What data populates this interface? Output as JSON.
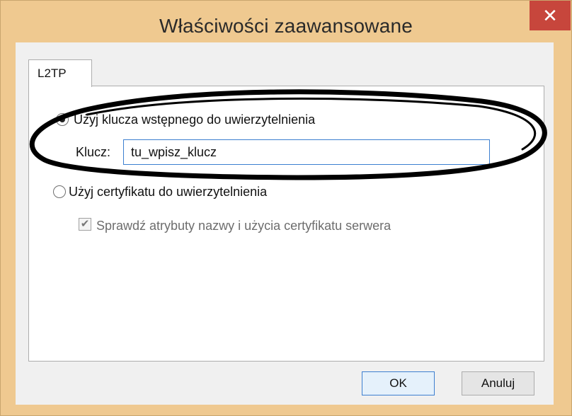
{
  "window": {
    "title": "Właściwości zaawansowane"
  },
  "tab": {
    "label": "L2TP"
  },
  "options": {
    "preshared_key_label": "Użyj klucza wstępnego do uwierzytelnienia",
    "key_label": "Klucz:",
    "key_value": "tu_wpisz_klucz",
    "certificate_label": "Użyj certyfikatu do uwierzytelnienia",
    "verify_cert_label": "Sprawdź atrybuty nazwy i użycia certyfikatu serwera"
  },
  "buttons": {
    "ok": "OK",
    "cancel": "Anuluj"
  },
  "icons": {
    "close": "close-icon",
    "check": "checkmark-icon"
  },
  "colors": {
    "frame": "#efc990",
    "close": "#c7463c",
    "accent": "#3c7fd0"
  }
}
